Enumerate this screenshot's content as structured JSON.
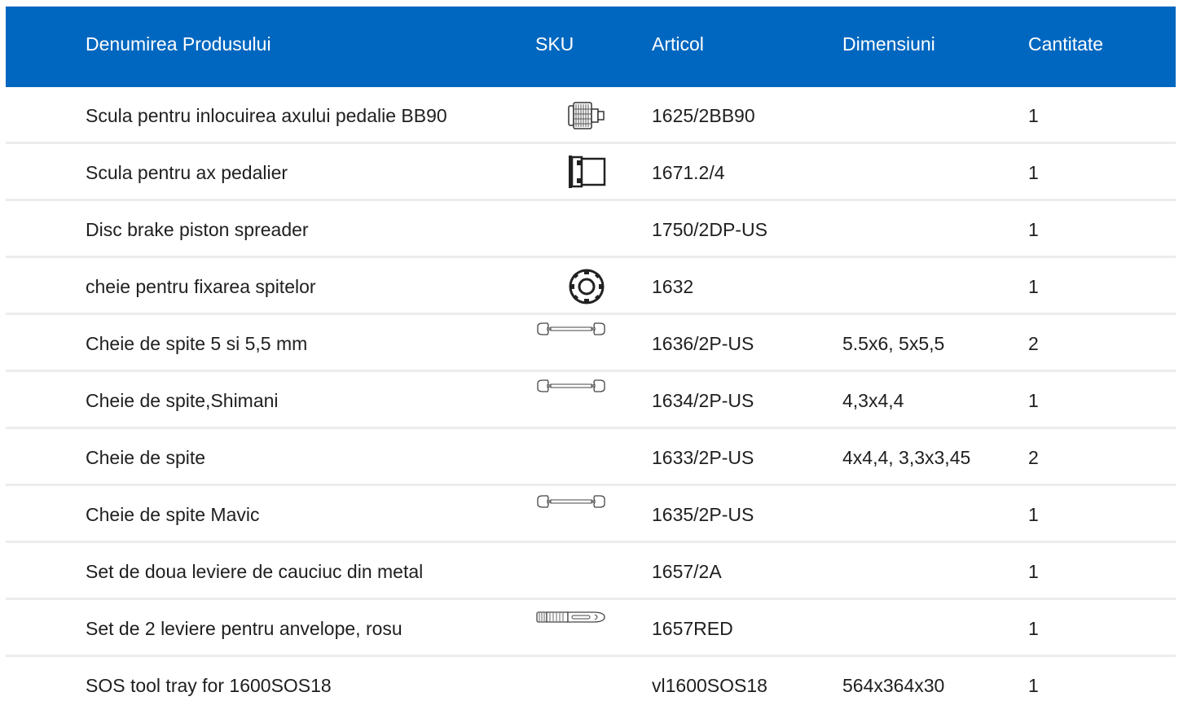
{
  "header": {
    "name": "Denumirea Produsului",
    "sku": "SKU",
    "article": "Articol",
    "dimensions": "Dimensiuni",
    "quantity": "Cantitate"
  },
  "colors": {
    "header_bg": "#0067c0",
    "header_text": "#ffffff",
    "row_divider": "#ececec"
  },
  "rows": [
    {
      "name": "Scula pentru inlocuirea axului pedalie BB90",
      "sku_icon": "bb90-tool-icon",
      "article": "1625/2BB90",
      "dimensions": "",
      "quantity": "1"
    },
    {
      "name": "Scula pentru ax pedalier",
      "sku_icon": "bottom-bracket-tool-icon",
      "article": "1671.2/4",
      "dimensions": "",
      "quantity": "1"
    },
    {
      "name": "Disc brake piston spreader",
      "sku_icon": "",
      "article": "1750/2DP-US",
      "dimensions": "",
      "quantity": "1"
    },
    {
      "name": "cheie pentru fixarea spitelor",
      "sku_icon": "lockring-tool-icon",
      "article": "1632",
      "dimensions": "",
      "quantity": "1"
    },
    {
      "name": "Cheie de spite 5 si 5,5 mm",
      "sku_icon": "spoke-wrench-icon",
      "article": "1636/2P-US",
      "dimensions": "5.5x6, 5x5,5",
      "quantity": "2"
    },
    {
      "name": "Cheie de spite,Shimani",
      "sku_icon": "spoke-wrench-icon",
      "article": "1634/2P-US",
      "dimensions": "4,3x4,4",
      "quantity": "1"
    },
    {
      "name": "Cheie de spite",
      "sku_icon": "",
      "article": "1633/2P-US",
      "dimensions": "4x4,4, 3,3x3,45",
      "quantity": "2"
    },
    {
      "name": "Cheie de spite Mavic",
      "sku_icon": "spoke-wrench-icon",
      "article": "1635/2P-US",
      "dimensions": "",
      "quantity": "1"
    },
    {
      "name": "Set de doua leviere de cauciuc din metal",
      "sku_icon": "",
      "article": "1657/2A",
      "dimensions": "",
      "quantity": "1"
    },
    {
      "name": "Set de 2 leviere pentru anvelope, rosu",
      "sku_icon": "tire-lever-icon",
      "article": "1657RED",
      "dimensions": "",
      "quantity": "1"
    },
    {
      "name": "SOS tool tray for 1600SOS18",
      "sku_icon": "",
      "article": "vl1600SOS18",
      "dimensions": "564x364x30",
      "quantity": "1"
    }
  ]
}
